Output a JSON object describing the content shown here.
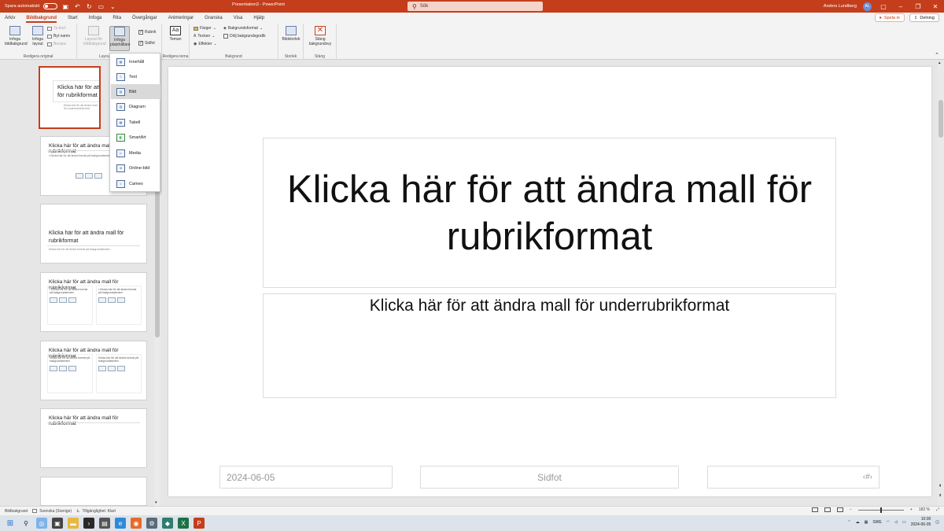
{
  "titlebar": {
    "autosave_label": "Spara automatiskt",
    "autosave_state": "off",
    "doc_title": "Presentation3 - PowerPoint",
    "search_label": "Sök",
    "user_name": "Anders Lundberg",
    "user_initials": "AL"
  },
  "tabs": [
    "Arkiv",
    "Bildbakgrund",
    "Start",
    "Infoga",
    "Rita",
    "Övergångar",
    "Animeringar",
    "Granska",
    "Visa",
    "Hjälp"
  ],
  "active_tab": "Bildbakgrund",
  "record_label": "Spela in",
  "share_label": "Delning",
  "ribbon": {
    "g1": {
      "label": "Redigera original",
      "b1": "Infoga bildbakgrund",
      "b2": "Infoga layout",
      "s1": "Ta bort",
      "s2": "Byt namn",
      "s3": "Bevara"
    },
    "g2": {
      "label": "Layout för bildbakgrund",
      "b1": "Layout för bildbakgrund",
      "b2": "Infoga platshållare",
      "c1": "Rubrik",
      "c2": "Sidfot"
    },
    "g3": {
      "label": "Redigera tema",
      "b1": "Teman"
    },
    "g4": {
      "label": "Bakgrund",
      "s1": "Färger",
      "s2": "Tecken",
      "s3": "Effekter",
      "s4": "Bakgrundsformat",
      "c1": "Dölj bakgrundsgrafik"
    },
    "g5": {
      "label": "Storlek",
      "b1": "Bildstorlek"
    },
    "g6": {
      "label": "Stäng",
      "b1": "Stäng bakgrundsvy"
    }
  },
  "placeholder_menu": [
    {
      "label": "Innehåll",
      "icon": "content-icon"
    },
    {
      "label": "Text",
      "icon": "text-icon"
    },
    {
      "label": "Bild",
      "icon": "picture-icon"
    },
    {
      "label": "Diagram",
      "icon": "chart-icon"
    },
    {
      "label": "Tabell",
      "icon": "table-icon"
    },
    {
      "label": "SmartArt",
      "icon": "smartart-icon"
    },
    {
      "label": "Media",
      "icon": "media-icon"
    },
    {
      "label": "Online-bild",
      "icon": "online-picture-icon"
    },
    {
      "label": "Cameo",
      "icon": "cameo-icon"
    }
  ],
  "thumbnails": [
    {
      "title": "Klicka här för att ändra mall för rubrikformat",
      "sub": "Klicka här för att ändra mall för underrubrikformat"
    },
    {
      "title": "Klicka här för att ändra mall för rubrikformat",
      "bullets": "• Klicka här för att ändra format på bakgrundstexten"
    },
    {
      "title": "Klicka här för att ändra mall för rubrikformat",
      "sub": "Klicka här för att ändra format på bakgrundstexten"
    },
    {
      "title": "Klicka här för att ändra mall för rubrikformat",
      "col1": "• Klicka här för att ändra format på bakgrundstexten",
      "col2": "• Klicka här för att ändra format på bakgrundstexten"
    },
    {
      "title": "Klicka här för att ändra mall för rubrikformat",
      "col1": "Klicka här för att ändra format på bakgrundstexten",
      "col2": "Klicka här för att ändra format på bakgrundstexten"
    },
    {
      "title": "Klicka här för att ändra mall för rubrikformat"
    },
    {
      "title": ""
    }
  ],
  "slide": {
    "title": "Klicka här för att ändra mall för rubrikformat",
    "subtitle": "Klicka här för att ändra mall för underrubrikformat",
    "date": "2024-06-05",
    "footer": "Sidfot",
    "page_number": "‹#›"
  },
  "statusbar": {
    "view": "Bildbakgrund",
    "language": "Svenska (Sverige)",
    "accessibility": "Tillgänglighet: Klart",
    "zoom": "182 %"
  },
  "taskbar": {
    "lang": "SWE",
    "time": "10:00",
    "date": "2024-06-05"
  }
}
